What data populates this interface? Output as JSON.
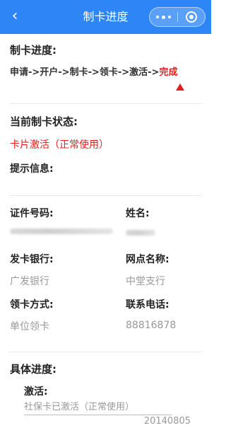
{
  "nav": {
    "title": "制卡进度",
    "back_icon": "chevron-left-icon"
  },
  "progress": {
    "label": "制卡进度:",
    "steps_done": "申请->开户->制卡->领卡->激活->",
    "step_current": "完成"
  },
  "status": {
    "label": "当前制卡状态:",
    "value": "卡片激活（正常使用）",
    "hint_label": "提示信息:"
  },
  "info": {
    "id_label": "证件号码:",
    "name_label": "姓名:",
    "bank_label": "发卡银行:",
    "bank_value": "广发银行",
    "branch_label": "网点名称:",
    "branch_value": "中堂支行",
    "pickup_label": "领卡方式:",
    "pickup_value": "单位领卡",
    "phone_label": "联系电话:",
    "phone_value": "88816878"
  },
  "detail": {
    "label": "具体进度:",
    "step_title": "激活:",
    "step_text": "社保卡已激活（正常使用）",
    "step_date": "20140805"
  },
  "colors": {
    "nav_bg": "#2e86f6",
    "accent_red": "#e02020",
    "muted": "#999999"
  }
}
